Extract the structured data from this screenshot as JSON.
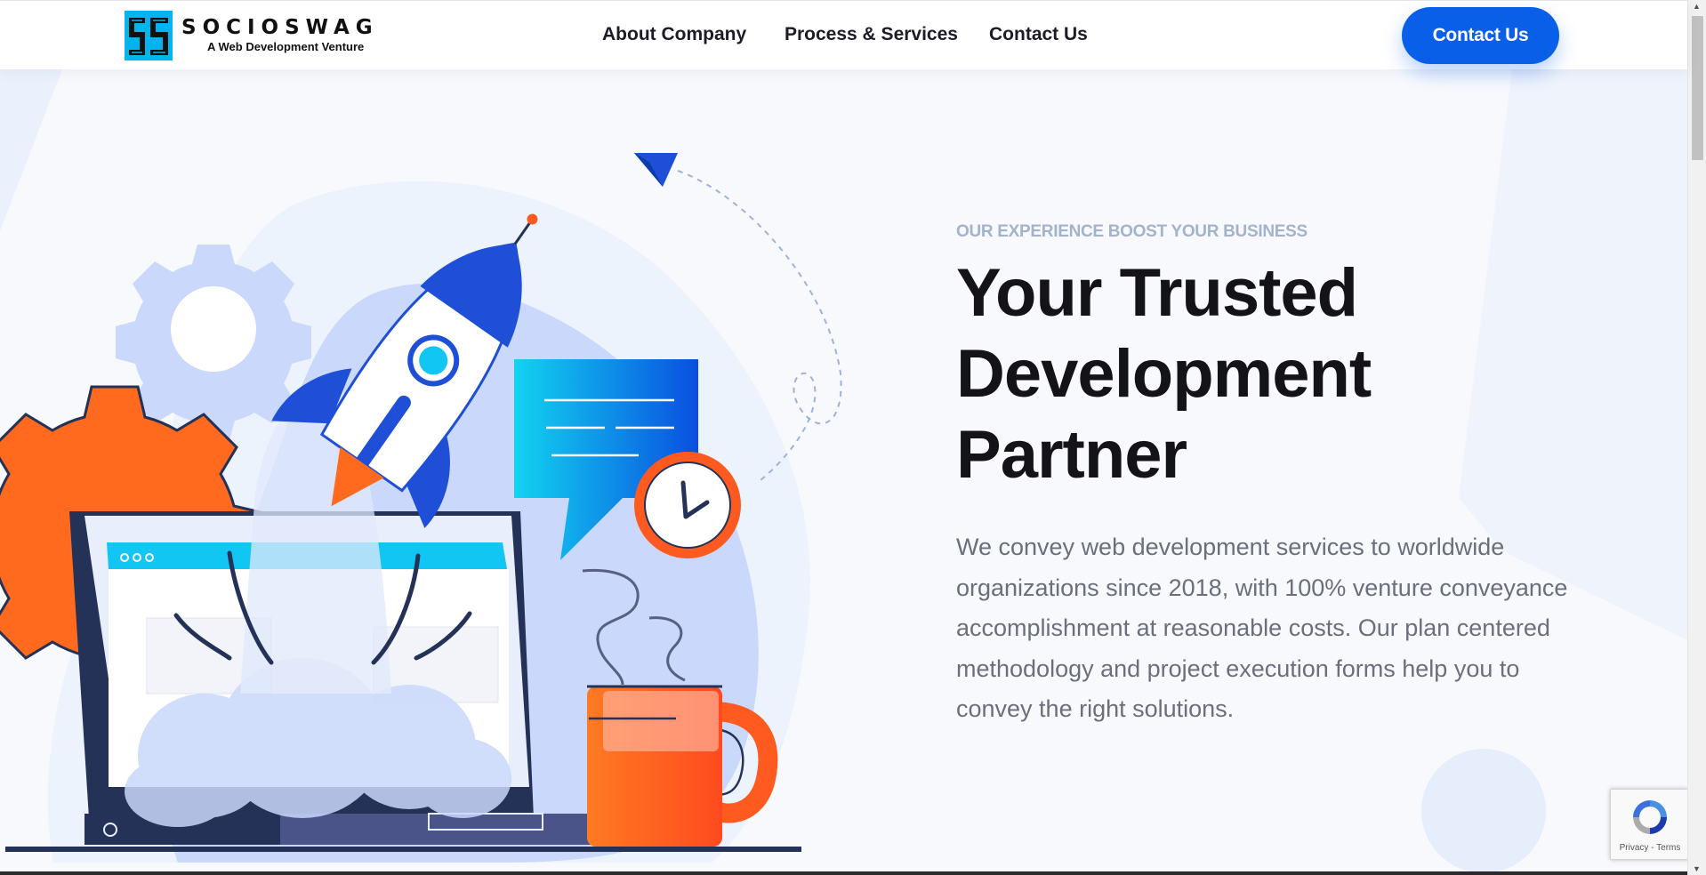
{
  "brand": {
    "name": "SOCIOSWAG",
    "tagline": "A Web Development Venture",
    "logo_colors": [
      "#00b4f0",
      "#111111"
    ]
  },
  "nav": {
    "items": [
      {
        "label": "About Company"
      },
      {
        "label": "Process & Services"
      },
      {
        "label": "Contact Us"
      }
    ],
    "cta_label": "Contact Us"
  },
  "hero": {
    "eyebrow": "OUR EXPERIENCE BOOST YOUR BUSINESS",
    "headline": [
      "Your Trusted",
      "Development",
      "Partner"
    ],
    "description": "We convey web development services to worldwide organizations since 2018, with 100% venture conveyance accomplishment at reasonable costs. Our plan centered methodology and project execution forms help you to convey the right solutions.",
    "illustration_icons": [
      "gear-icon",
      "rocket-icon",
      "laptop-icon",
      "chat-bubble-icon",
      "clock-icon",
      "coffee-mug-icon",
      "paper-plane-icon"
    ]
  },
  "recaptcha": {
    "privacy": "Privacy",
    "separator": " - ",
    "terms": "Terms"
  },
  "colors": {
    "accent": "#0a5fe8",
    "orange": "#ff5a1f",
    "soft_blue": "#c9d8fb",
    "eyebrow": "#a3b3cc",
    "heading": "#141418",
    "body_text": "#6a6f7b"
  }
}
